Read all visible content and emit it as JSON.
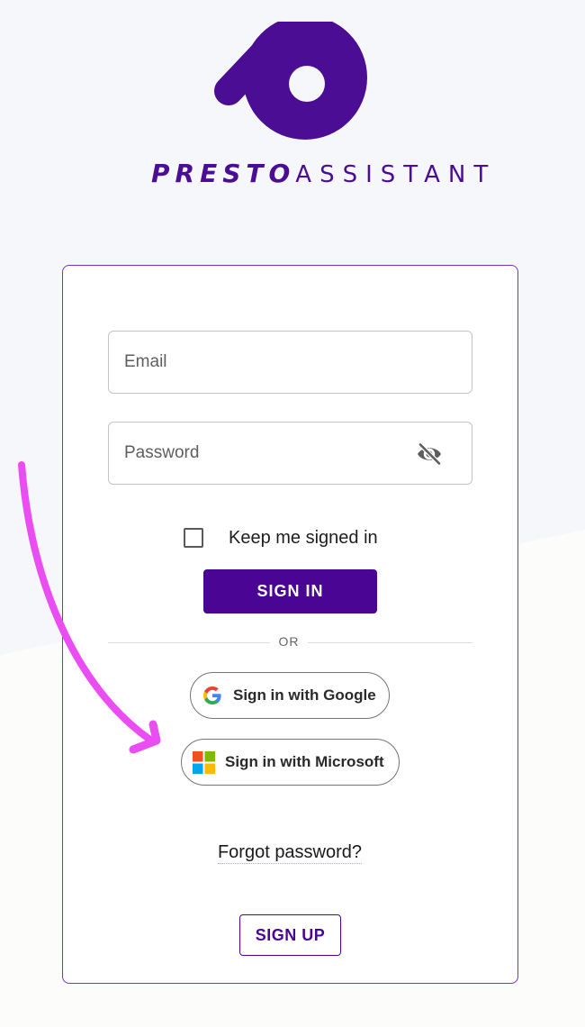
{
  "brand": {
    "name_bold": "PRESTO",
    "name_light": "ASSISTANT",
    "color": "#4b0d94"
  },
  "login": {
    "email_placeholder": "Email",
    "password_placeholder": "Password",
    "password_visibility_icon": "eye-off-icon",
    "keep_signed_in_label": "Keep me signed in",
    "keep_signed_in_checked": false,
    "sign_in_label": "SIGN IN",
    "divider_label": "OR",
    "google_label": "Sign in with Google",
    "microsoft_label": "Sign in with Microsoft",
    "forgot_label": "Forgot password?",
    "sign_up_label": "SIGN UP"
  },
  "colors": {
    "primary": "#4b0595",
    "card_border": "#7a2fd0",
    "annotation_arrow": "#ea4ef2"
  },
  "annotation": {
    "icon": "curved-arrow-icon",
    "points_to": "microsoft-button"
  }
}
